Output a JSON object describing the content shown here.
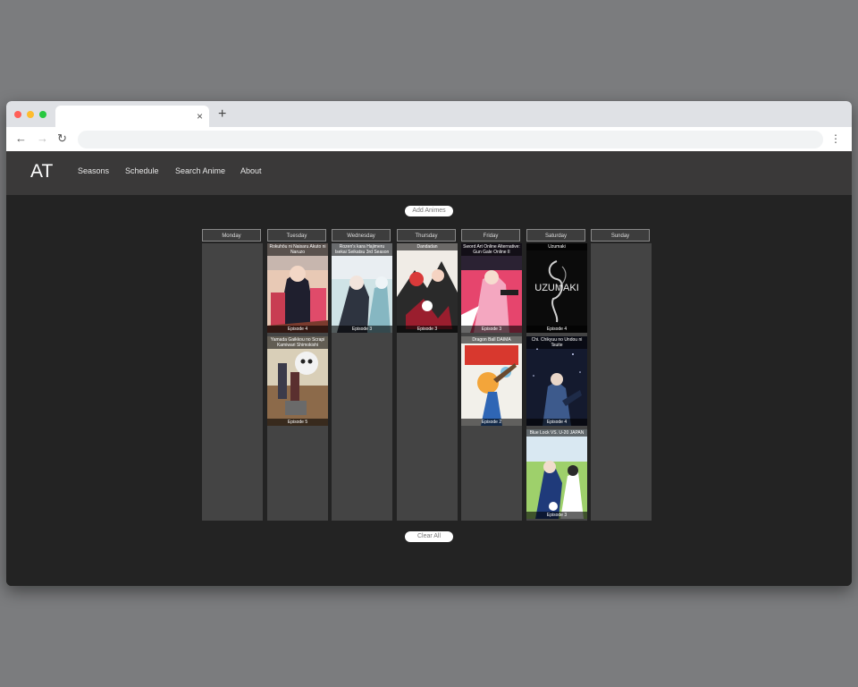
{
  "app": {
    "logo": "AT"
  },
  "browser": {
    "tab_close": "×",
    "new_tab": "+",
    "back": "←",
    "forward": "→",
    "reload": "↻",
    "menu": "⋮"
  },
  "nav": {
    "items": [
      "Seasons",
      "Schedule",
      "Search Anime",
      "About"
    ]
  },
  "actions": {
    "add_label": "Add Animes",
    "clear_label": "Clear All"
  },
  "days": [
    "Monday",
    "Tuesday",
    "Wednesday",
    "Thursday",
    "Friday",
    "Saturday",
    "Sunday"
  ],
  "schedule": {
    "tuesday": [
      {
        "title": "Rokuhōu ni Naisaru Akuto ni Naruzo",
        "episode": "Episode 4"
      },
      {
        "title": "Yamada Gaikkou no Scrapi Kamiwari Shimokishi",
        "episode": "Episode 5"
      }
    ],
    "wednesday": [
      {
        "title": "Rozen's kara Hajimeru Isekai Seikatsu 3rd Season",
        "episode": "Episode 3"
      }
    ],
    "thursday": [
      {
        "title": "Dandadan",
        "episode": "Episode 3"
      }
    ],
    "friday": [
      {
        "title": "Sword Art Online Alternative: Gun Gale Online II",
        "episode": "Episode 3"
      },
      {
        "title": "Dragon Ball DAIMA",
        "episode": "Episode 2"
      }
    ],
    "saturday": [
      {
        "title": "Uzumaki",
        "episode": "Episode 4",
        "art_text": "UZUMAKI"
      },
      {
        "title": "Chi. Chikyuu no Undou ni Tsuite",
        "episode": "Episode 4"
      },
      {
        "title": "Blue Lock VS. U-20 JAPAN",
        "episode": "Episode 3"
      }
    ]
  },
  "colors": {
    "app_bg": "#232323",
    "header_bg": "#3a3939",
    "column_bg": "#444444",
    "page_bg": "#7b7c7e"
  }
}
